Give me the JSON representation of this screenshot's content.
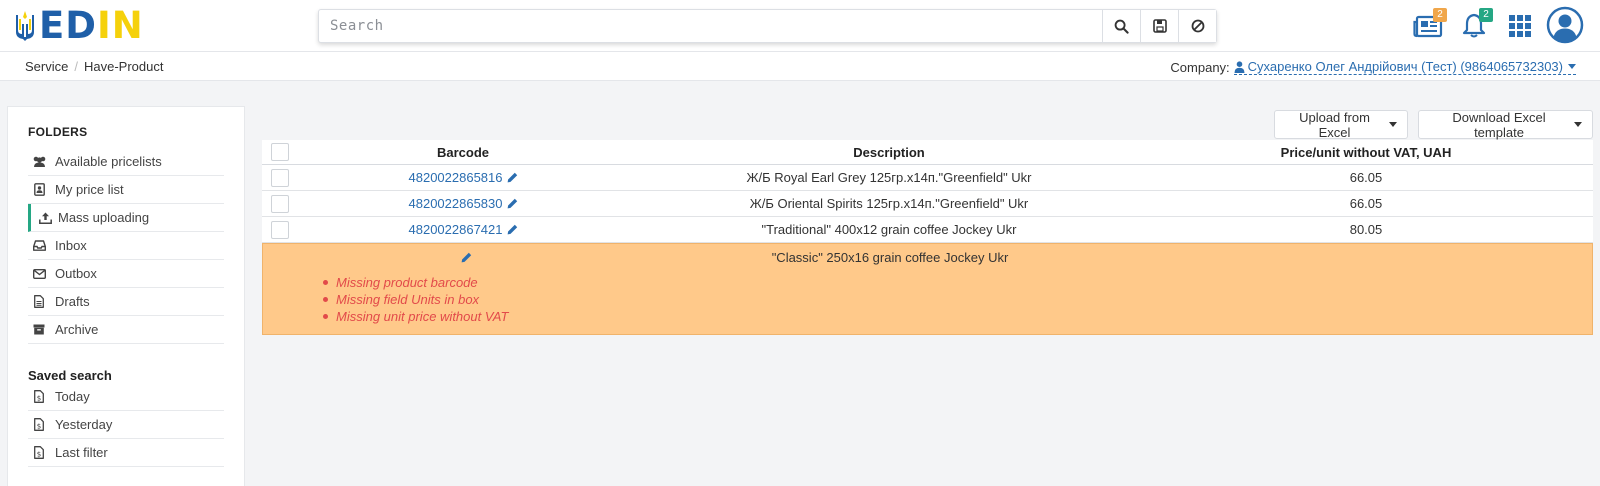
{
  "app": {
    "logo_text": "EDIN"
  },
  "search": {
    "placeholder": "Search"
  },
  "top_icons": {
    "news_badge": "2",
    "notifications_badge": "2"
  },
  "breadcrumb": {
    "items": [
      "Service",
      "Have-Product"
    ],
    "separator": "/"
  },
  "company": {
    "label": "Company:",
    "value": "Сухаренко Олег Андрійович (Тест) (9864065732303)"
  },
  "sidebar": {
    "folders_heading": "FOLDERS",
    "items": [
      {
        "label": "Available pricelists",
        "icon": "users-icon"
      },
      {
        "label": "My price list",
        "icon": "contact-card-icon"
      },
      {
        "label": "Mass uploading",
        "icon": "upload-icon",
        "active": true
      },
      {
        "label": "Inbox",
        "icon": "inbox-icon"
      },
      {
        "label": "Outbox",
        "icon": "envelope-icon"
      },
      {
        "label": "Drafts",
        "icon": "file-icon"
      },
      {
        "label": "Archive",
        "icon": "archive-icon"
      }
    ],
    "saved_heading": "Saved search",
    "saved_items": [
      {
        "label": "Today",
        "icon": "file-dollar-icon"
      },
      {
        "label": "Yesterday",
        "icon": "file-dollar-icon"
      },
      {
        "label": "Last filter",
        "icon": "file-dollar-icon"
      }
    ]
  },
  "actions": {
    "upload_excel": "Upload from Excel",
    "download_template": "Download Excel template"
  },
  "table": {
    "headers": {
      "barcode": "Barcode",
      "description": "Description",
      "price": "Price/unit without VAT, UAH"
    },
    "rows": [
      {
        "barcode": "4820022865816",
        "description": "Ж/Б Royal Earl Grey 125гр.х14п.\"Greenfield\" Ukr",
        "price": "66.05"
      },
      {
        "barcode": "4820022865830",
        "description": "Ж/Б Oriental Spirits 125гр.х14п.\"Greenfield\" Ukr",
        "price": "66.05"
      },
      {
        "barcode": "4820022867421",
        "description": "\"Traditional\" 400x12 grain coffee Jockey Ukr",
        "price": "80.05"
      }
    ],
    "error_row": {
      "barcode": "",
      "description": "\"Classic\" 250x16 grain coffee Jockey Ukr",
      "errors": [
        "Missing product barcode",
        "Missing field Units in box",
        "Missing unit price without VAT"
      ]
    }
  },
  "colors": {
    "accent_blue": "#2a6db0",
    "active_green": "#25a784",
    "badge_orange": "#f0a64a",
    "error_row_bg": "#ffc98a",
    "error_text": "#e24a4a"
  }
}
